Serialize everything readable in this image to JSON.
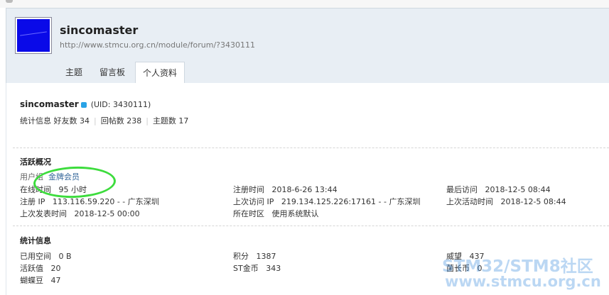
{
  "header": {
    "username": "sincomaster",
    "space_url": "http://www.stmcu.org.cn/module/forum/?3430111"
  },
  "tabs": [
    {
      "label": "主题"
    },
    {
      "label": "留言板"
    },
    {
      "label": "个人资料",
      "active": true
    }
  ],
  "profile": {
    "username": "sincomaster",
    "uid": "(UID: 3430111)",
    "stats_label": "统计信息",
    "friends": "好友数 34",
    "replies": "回帖数 238",
    "threads": "主题数 17"
  },
  "activity": {
    "heading": "活跃概况",
    "usergroup_label": "用户组",
    "usergroup_value": "金牌会员",
    "online_label": "在线时间",
    "online_value": "95 小时",
    "register_time_label": "注册时间",
    "register_time_value": "2018-6-26 13:44",
    "last_visit_label": "最后访问",
    "last_visit_value": "2018-12-5 08:44",
    "register_ip_label": "注册 IP",
    "register_ip_value": "113.116.59.220 - - 广东深圳",
    "last_ip_label": "上次访问 IP",
    "last_ip_value": "219.134.125.226:17161 - - 广东深圳",
    "last_active_label": "上次活动时间",
    "last_active_value": "2018-12-5 08:44",
    "last_post_label": "上次发表时间",
    "last_post_value": "2018-12-5 00:00",
    "timezone_label": "所在时区",
    "timezone_value": "使用系统默认"
  },
  "statistics": {
    "heading": "统计信息",
    "space_label": "已用空间",
    "space_value": "0 B",
    "points_label": "积分",
    "points_value": "1387",
    "prestige_label": "威望",
    "prestige_value": "437",
    "activity_label": "活跃值",
    "activity_value": "20",
    "stcoin_label": "ST金币",
    "stcoin_value": "343",
    "lingchang_label": "菌长币",
    "lingchang_value": "0",
    "butterfly_label": "蝴蝶豆",
    "butterfly_value": "47"
  },
  "watermark": {
    "line1": "STM32/STM8社区",
    "line2": "www.stmcu.org.cn"
  },
  "colors": {
    "header_bg": "#e8eef4",
    "avatar": "#0a0ae8",
    "annotation": "#3ddc3d",
    "link": "#336699"
  }
}
